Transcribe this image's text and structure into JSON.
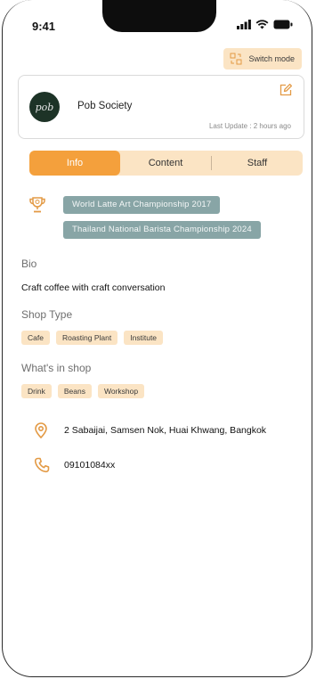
{
  "status_bar": {
    "time": "9:41"
  },
  "header": {
    "switch_mode_label": "Switch mode"
  },
  "profile": {
    "avatar_text": "pob",
    "shop_name": "Pob Society",
    "last_update": "Last Update : 2 hours ago"
  },
  "tabs": [
    {
      "label": "Info",
      "active": true
    },
    {
      "label": "Content",
      "active": false
    },
    {
      "label": "Staff",
      "active": false
    }
  ],
  "awards": [
    "World Latte Art Championship 2017",
    "Thailand National Barista Championship 2024"
  ],
  "bio": {
    "label": "Bio",
    "text": "Craft coffee with craft conversation"
  },
  "shop_type": {
    "label": "Shop Type",
    "chips": [
      "Cafe",
      "Roasting Plant",
      "Institute"
    ]
  },
  "whats_in_shop": {
    "label": "What's in shop",
    "chips": [
      "Drink",
      "Beans",
      "Workshop"
    ]
  },
  "contact": {
    "address": "2 Sabaijai, Samsen Nok, Huai Khwang, Bangkok",
    "phone": "09101084xx"
  },
  "colors": {
    "accent": "#f4a03c",
    "chip_bg": "#fbe4c4",
    "award_bg": "#88a5a6",
    "avatar_bg": "#1d3327"
  }
}
